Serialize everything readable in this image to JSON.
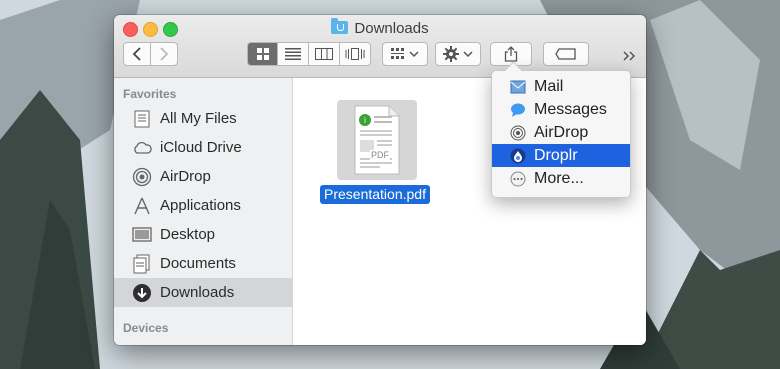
{
  "window": {
    "title": "Downloads"
  },
  "toolbar": {
    "back_icon": "chevron-left-icon",
    "forward_icon": "chevron-right-icon",
    "views": [
      "icon-view-icon",
      "list-view-icon",
      "column-view-icon",
      "cover-flow-icon"
    ],
    "arrange_icon": "arrange-icon",
    "action_icon": "gear-icon",
    "share_icon": "share-icon",
    "tag_icon": "tag-icon",
    "overflow_icon": "double-chevron-right-icon"
  },
  "sidebar": {
    "favorites_heading": "Favorites",
    "items": [
      {
        "label": "All My Files",
        "icon": "all-files-icon"
      },
      {
        "label": "iCloud Drive",
        "icon": "cloud-icon"
      },
      {
        "label": "AirDrop",
        "icon": "airdrop-icon"
      },
      {
        "label": "Applications",
        "icon": "applications-icon"
      },
      {
        "label": "Desktop",
        "icon": "desktop-icon"
      },
      {
        "label": "Documents",
        "icon": "documents-icon"
      },
      {
        "label": "Downloads",
        "icon": "downloads-icon",
        "selected": true
      }
    ],
    "devices_heading": "Devices"
  },
  "content": {
    "file": {
      "name": "Presentation.pdf",
      "thumb_text": "PDF"
    }
  },
  "share_menu": {
    "items": [
      {
        "label": "Mail",
        "icon": "mail-icon"
      },
      {
        "label": "Messages",
        "icon": "messages-icon"
      },
      {
        "label": "AirDrop",
        "icon": "airdrop-icon"
      },
      {
        "label": "Droplr",
        "icon": "droplr-icon",
        "highlighted": true
      },
      {
        "label": "More...",
        "icon": "more-icon"
      }
    ]
  },
  "colors": {
    "selection": "#1b6bd8",
    "menu_highlight": "#1f62e0",
    "sidebar_bg": "#eef0f2"
  }
}
